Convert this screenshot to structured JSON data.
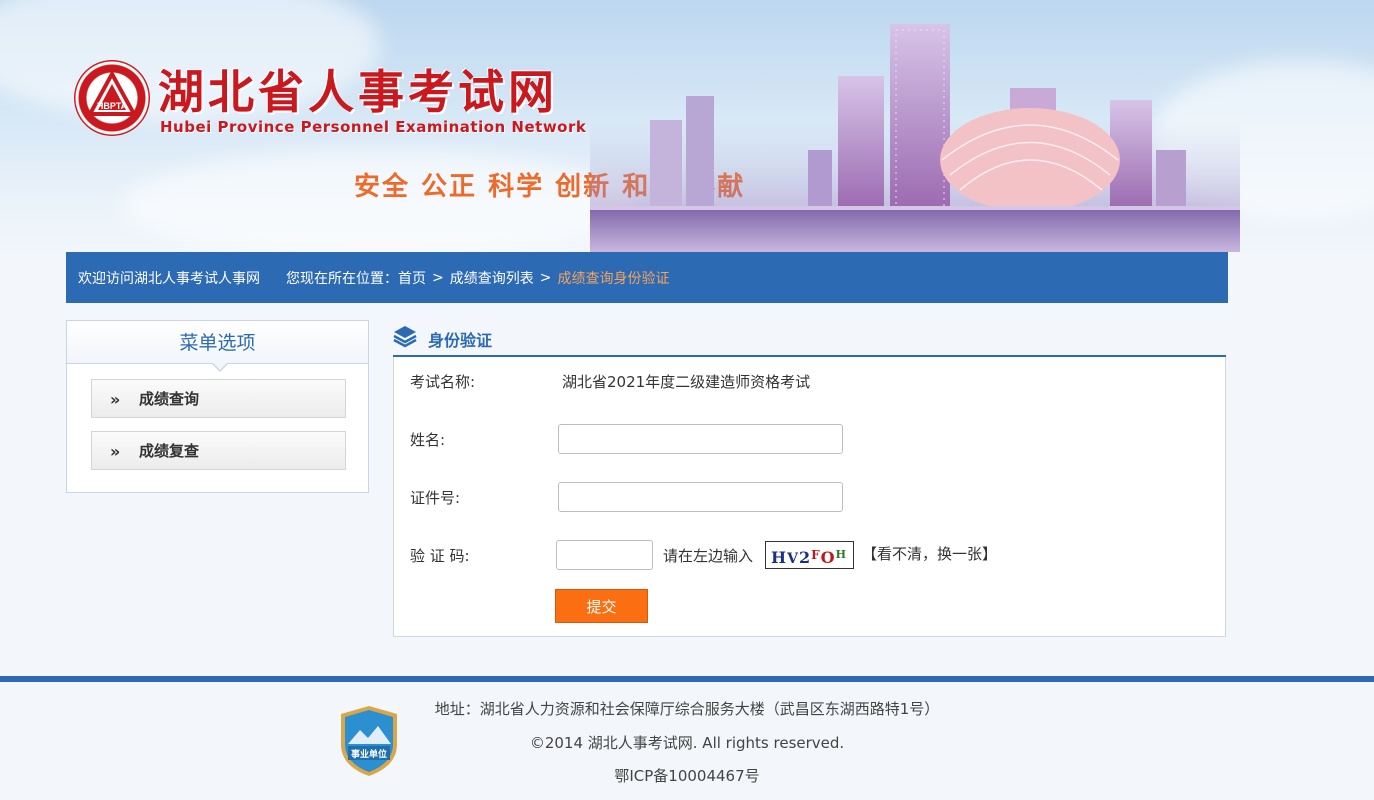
{
  "header": {
    "title": "湖北省人事考试网",
    "subtitle": "Hubei Province Personnel Examination Network",
    "emblem_text": "HBPTA",
    "slogan": "安全  公正  科学  创新  和谐  奉献"
  },
  "nav": {
    "welcome": "欢迎访问湖北人事考试人事网",
    "location_label": "您现在所在位置：",
    "crumbs": [
      "首页",
      "成绩查询列表",
      "成绩查询身份验证"
    ],
    "separator": ">"
  },
  "menu": {
    "title": "菜单选项",
    "items": [
      {
        "chevron": "»",
        "label": "成绩查询"
      },
      {
        "chevron": "»",
        "label": "成绩复查"
      }
    ]
  },
  "panel": {
    "title": "身份验证",
    "exam_label": "考试名称:",
    "exam_value": "湖北省2021年度二级建造师资格考试",
    "name_label": "姓名:",
    "name_value": "",
    "id_label": "证件号:",
    "id_value": "",
    "captcha_label": "验 证 码:",
    "captcha_value": "",
    "captcha_hint": "请在左边输入",
    "captcha_chars": [
      "H",
      "V",
      "2",
      "F",
      "O",
      "H"
    ],
    "refresh_text": "【看不清，换一张】",
    "submit_label": "提交"
  },
  "footer": {
    "address": "地址：湖北省人力资源和社会保障厅综合服务大楼（武昌区东湖西路特1号）",
    "copyright": "©2014 湖北人事考试网. All rights reserved.",
    "icp": "鄂ICP备10004467号",
    "badge_text": "事业单位"
  },
  "colors": {
    "brand_blue": "#2c6ab3",
    "brand_red": "#c9191e",
    "accent_orange": "#fb6e12",
    "current_crumb": "#f7a35c"
  }
}
